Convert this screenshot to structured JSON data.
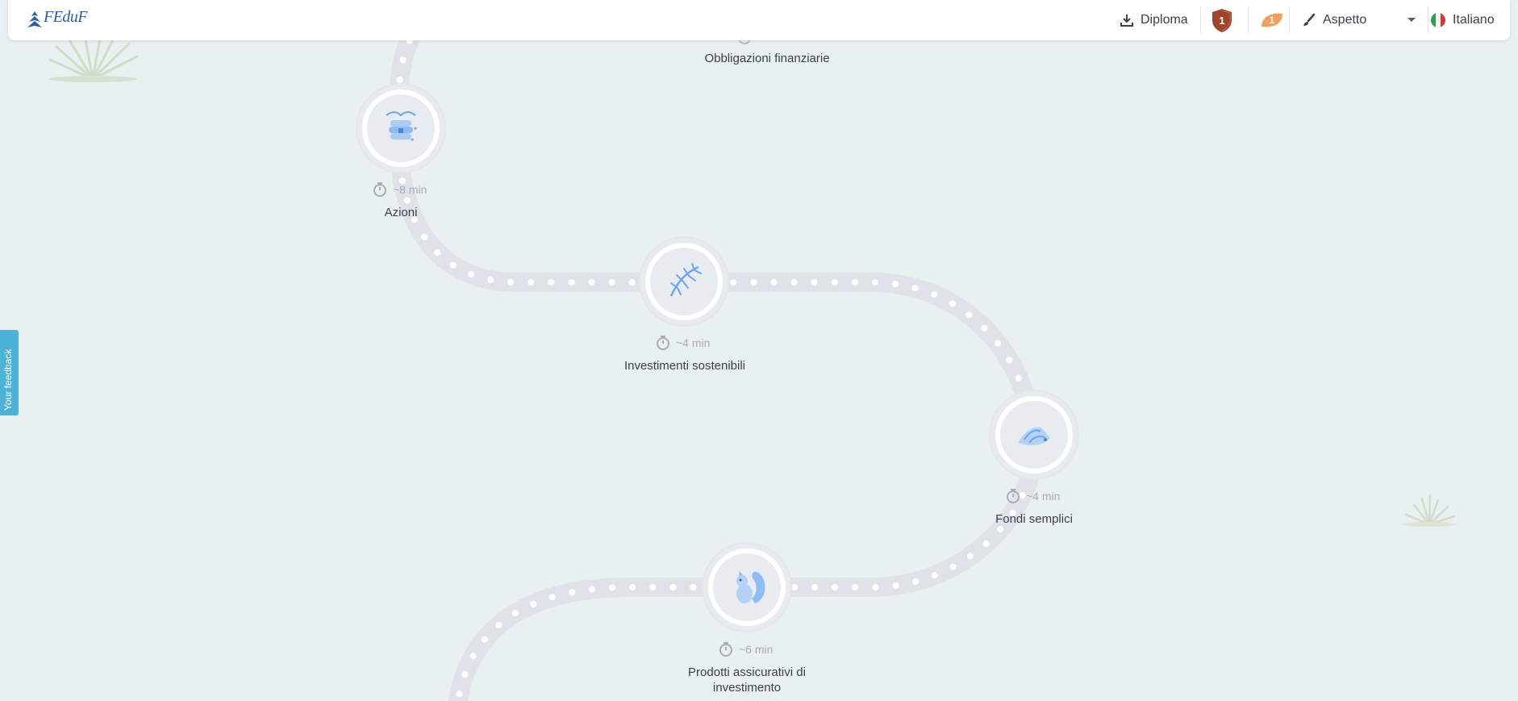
{
  "header": {
    "logo_text": "FEduF",
    "diploma_label": "Diploma",
    "shield_badge": "1",
    "leaf_badge": "1",
    "appearance_label": "Aspetto",
    "language_label": "Italiano"
  },
  "feedback_label": "Your feedback",
  "lessons": [
    {
      "title": "Obbligazioni finanziarie",
      "time": ""
    },
    {
      "title": "Azioni",
      "time": "~8 min"
    },
    {
      "title": "Investimenti sostenibili",
      "time": "~4 min"
    },
    {
      "title": "Fondi semplici",
      "time": "~4 min"
    },
    {
      "title": "Prodotti assicurativi di investimento",
      "time": "~6 min"
    }
  ],
  "colors": {
    "background": "#e9f0f1",
    "road": "#dfe3e9",
    "accent_blue": "#6aa6f0",
    "feedback": "#4db3d6",
    "shield": "#a0442d",
    "leaf": "#f0a05a"
  }
}
